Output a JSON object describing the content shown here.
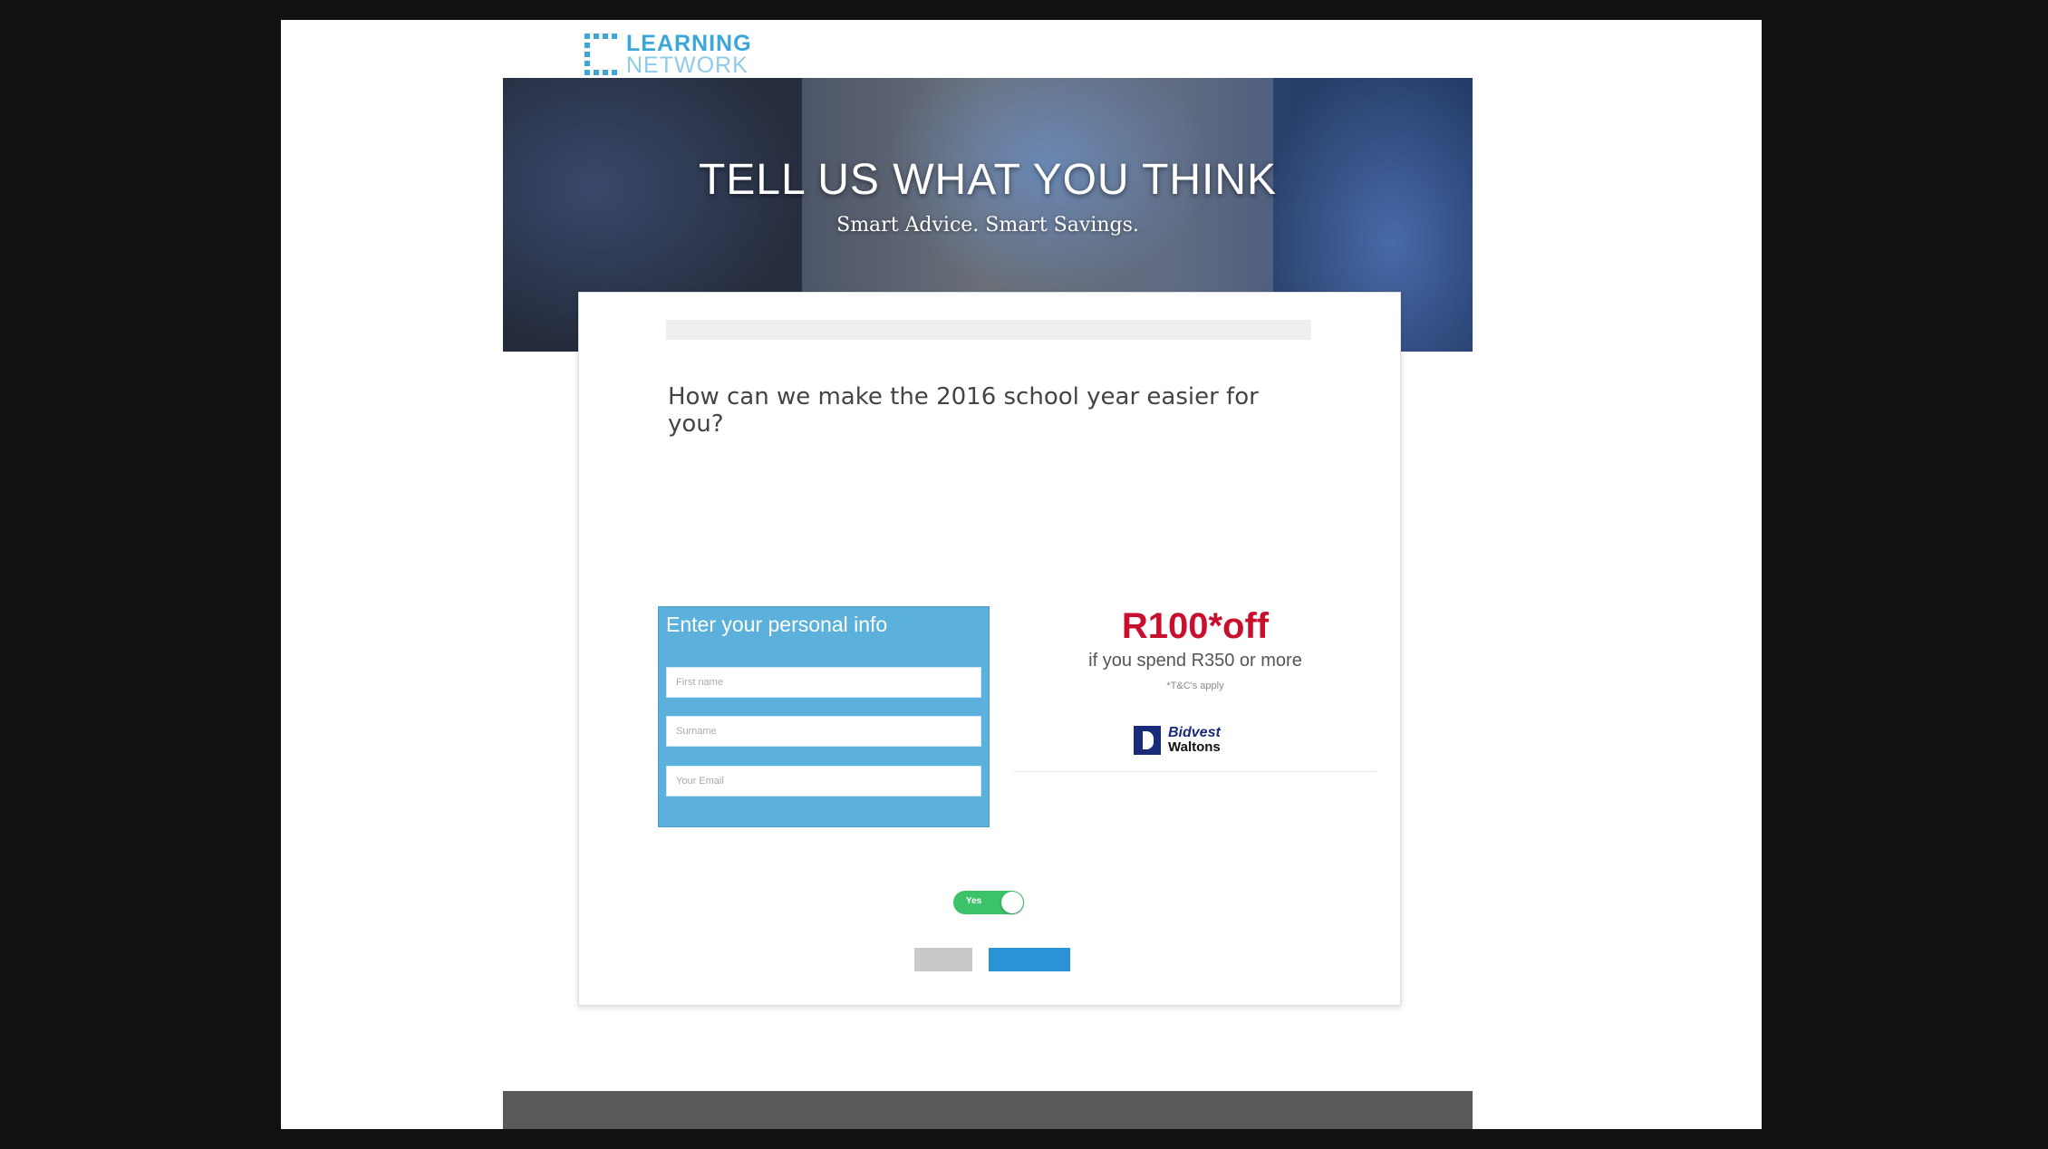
{
  "logo": {
    "line1": "LEARNING",
    "line2": "NETWORK"
  },
  "hero": {
    "title": "TELL US WHAT YOU THINK",
    "subtitle": "Smart Advice. Smart Savings."
  },
  "survey": {
    "progress_text": "",
    "progress": 0.0,
    "question": "How can we make the 2016 school year easier for you?",
    "paragraph1": "",
    "paragraph2": ""
  },
  "form": {
    "title": "Enter your personal info",
    "first_name_placeholder": "First name",
    "surname_placeholder": "Surname",
    "email_placeholder": "Your Email"
  },
  "offer": {
    "amount": "R100*off",
    "condition": "if you spend R350 or more",
    "tcs": "*T&C's apply",
    "brand_line1": "Bidvest",
    "brand_line2": "Waltons"
  },
  "consent": {
    "text": ""
  },
  "toggle": {
    "label": "Yes",
    "on": true
  },
  "buttons": {
    "back": "",
    "forward": ""
  },
  "footer": {
    "text": ""
  },
  "colors": {
    "accent": "#3aa7d8",
    "form_panel": "#5bb1dc",
    "offer_red": "#c8102e",
    "toggle_green": "#3cc36a",
    "forward_blue": "#2a94d6",
    "footer_gray": "#5a5a5a"
  }
}
